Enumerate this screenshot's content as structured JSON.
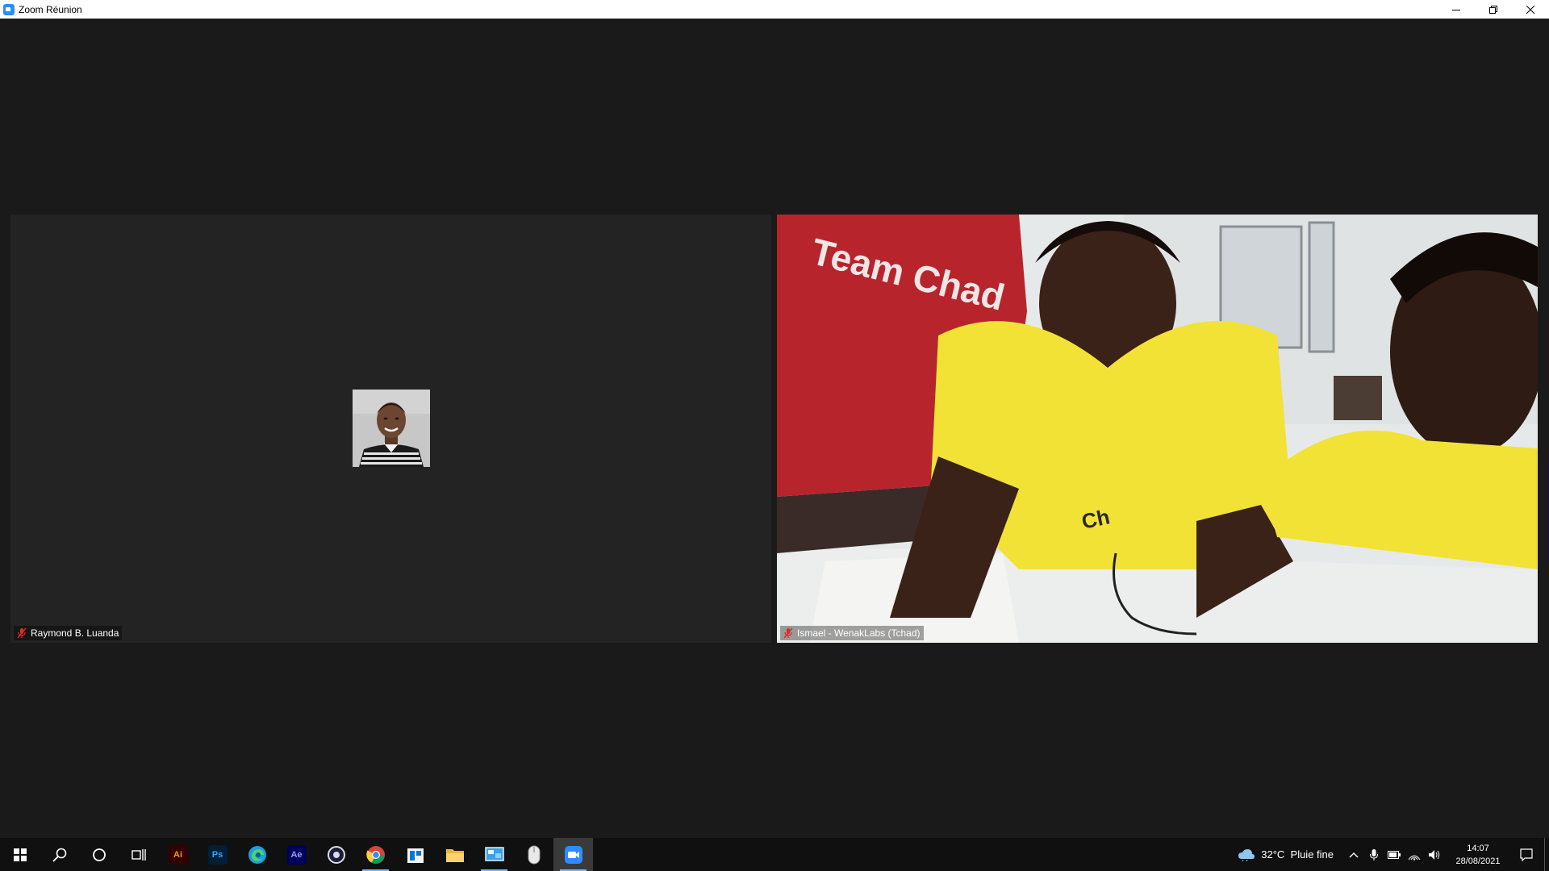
{
  "window": {
    "title": "Zoom Réunion",
    "icon": "zoom-icon"
  },
  "participants": [
    {
      "name": "Raymond B. Luanda",
      "video": false,
      "muted": true
    },
    {
      "name": "Ismael - WenakLabs (Tchad)",
      "video": true,
      "muted": true
    }
  ],
  "taskbar": {
    "apps": [
      {
        "name": "start",
        "icon": "windows-start-icon"
      },
      {
        "name": "search",
        "icon": "search-icon"
      },
      {
        "name": "cortana",
        "icon": "cortana-circle-icon"
      },
      {
        "name": "task-view",
        "icon": "task-view-icon"
      },
      {
        "name": "illustrator",
        "badge": "Ai",
        "bg": "#330000",
        "fg": "#ff9a00"
      },
      {
        "name": "photoshop",
        "badge": "Ps",
        "bg": "#001e36",
        "fg": "#31a8ff"
      },
      {
        "name": "edge",
        "icon": "edge-icon"
      },
      {
        "name": "after-effects",
        "badge": "Ae",
        "bg": "#00005b",
        "fg": "#9999ff"
      },
      {
        "name": "cinema4d",
        "icon": "cinema4d-icon"
      },
      {
        "name": "chrome",
        "icon": "chrome-icon",
        "running": true
      },
      {
        "name": "store",
        "icon": "store-icon"
      },
      {
        "name": "file-explorer",
        "icon": "folder-icon"
      },
      {
        "name": "control-panel",
        "icon": "control-panel-icon",
        "running": true
      },
      {
        "name": "teamviewer",
        "icon": "mouse-icon"
      },
      {
        "name": "zoom",
        "icon": "zoom-camera-icon",
        "running": true,
        "active": true
      }
    ],
    "weather": {
      "text": "32°C  Pluie fine",
      "icon": "cloud-rain-icon"
    },
    "clock": {
      "time": "14:07",
      "date": "28/08/2021"
    }
  },
  "colors": {
    "zoom_blue": "#2d8cff",
    "meeting_bg": "#1a1a1a",
    "tile_bg": "#232323",
    "muted_red": "#e02828"
  }
}
